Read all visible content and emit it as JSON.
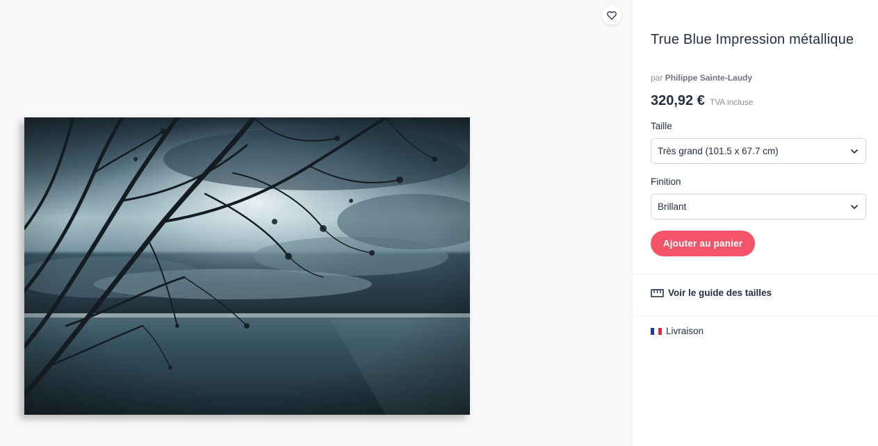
{
  "preview": {
    "favorite_icon": "heart-outline-icon",
    "artwork_alt": "tree-branches-over-sea-photo"
  },
  "product": {
    "title": "True Blue Impression métallique",
    "by_prefix": "par",
    "artist": "Philippe Sainte-Laudy",
    "price": "320,92 €",
    "vat_note": "TVA incluse"
  },
  "options": {
    "size": {
      "label": "Taille",
      "selected": "Très grand (101.5 x 67.7 cm)"
    },
    "finish": {
      "label": "Finition",
      "selected": "Brillant"
    }
  },
  "actions": {
    "add_to_cart": "Ajouter au panier",
    "size_guide": "Voir le guide des tailles",
    "shipping": "Livraison"
  },
  "colors": {
    "accent": "#f4546a",
    "text": "#262d49",
    "muted": "#8d8f99",
    "flag_blue": "#1f3a9c",
    "flag_white": "#ffffff",
    "flag_red": "#e5263b"
  }
}
